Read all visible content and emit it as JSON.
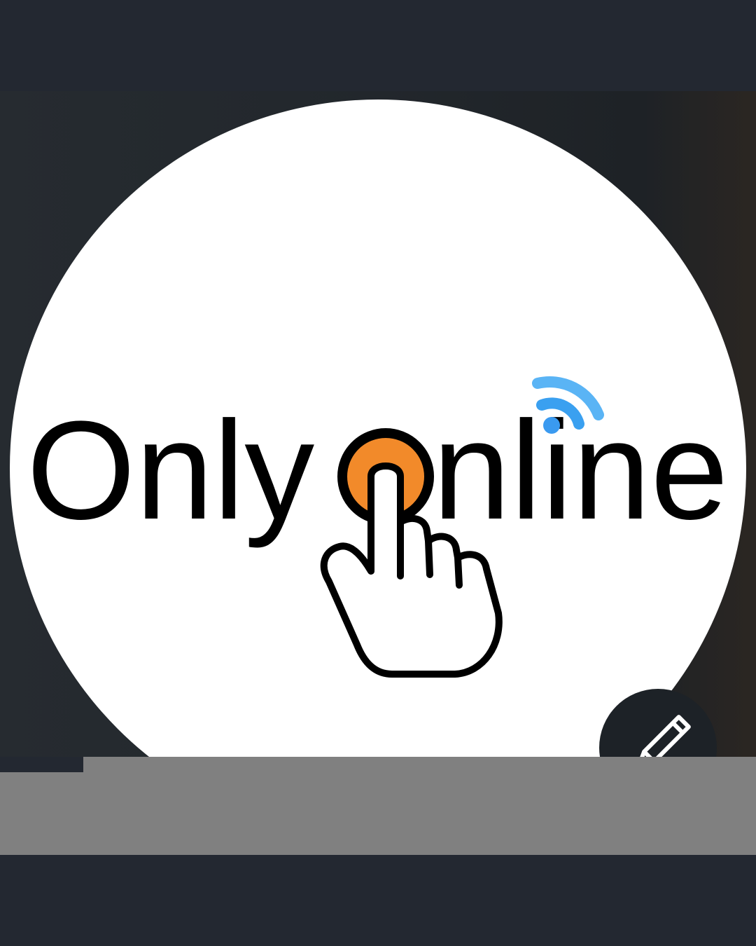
{
  "profile_photo": {
    "logo_text_line1": "Only",
    "logo_text_line2": "nline",
    "colors": {
      "orange": "#f28a2a",
      "wifi_blue": "#3aa0f0",
      "ink": "#000000",
      "circle_bg": "#ffffff"
    },
    "icons": [
      "wifi-icon",
      "pointing-hand-icon"
    ]
  },
  "edit_button": {
    "icon": "pencil-icon"
  }
}
